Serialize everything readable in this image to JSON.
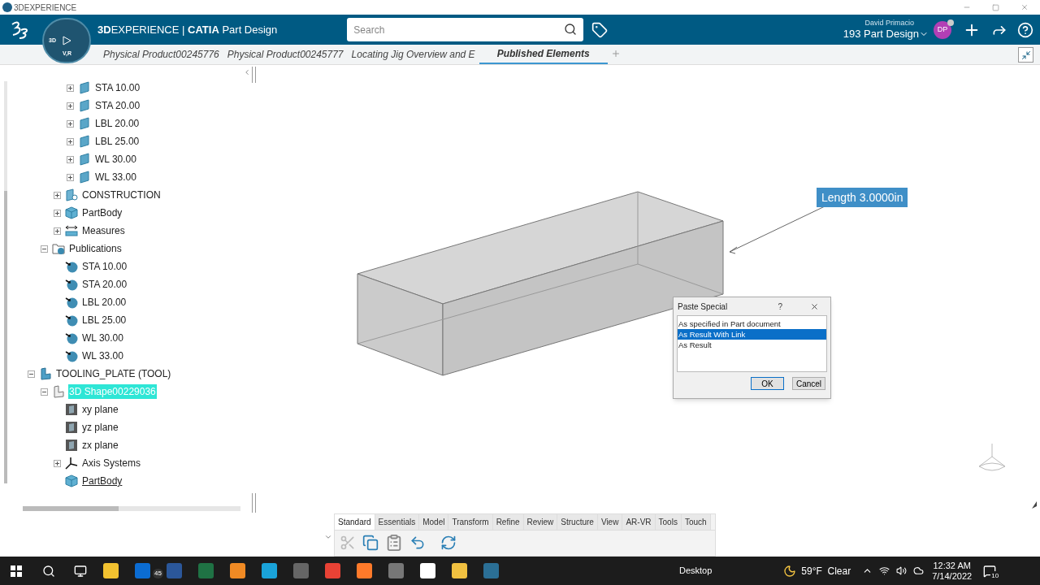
{
  "window": {
    "title": "3DEXPERIENCE"
  },
  "header": {
    "app_title": "**3D**EXPERIENCE | **CATIA** Part Design",
    "compass_labels": [
      "3D",
      "V,R"
    ],
    "search": {
      "placeholder": "Search"
    },
    "user_name": "David Primacio",
    "space": "193 Part Design",
    "avatar": "DP"
  },
  "tabs": [
    {
      "label": "Physical Product00245776",
      "selected": false
    },
    {
      "label": "Physical Product00245777",
      "selected": false
    },
    {
      "label": "Locating Jig Overview and E",
      "selected": false
    },
    {
      "label": "Published Elements",
      "selected": true
    }
  ],
  "tree": {
    "nodes": [
      {
        "children": [
          {
            "children": [
              {
                "children": [
                  {
                    "label": "STA 10.00",
                    "kind": "plane-set",
                    "expanded": false,
                    "selected": false
                  },
                  {
                    "label": "STA 20.00",
                    "kind": "plane-set",
                    "expanded": false,
                    "selected": false
                  },
                  {
                    "label": "LBL 20.00",
                    "kind": "plane-set",
                    "expanded": false,
                    "selected": false
                  },
                  {
                    "label": "LBL 25.00",
                    "kind": "plane-set",
                    "expanded": false,
                    "selected": false
                  },
                  {
                    "label": "WL 30.00",
                    "kind": "plane-set",
                    "expanded": false,
                    "selected": false
                  },
                  {
                    "label": "WL 33.00",
                    "kind": "plane-set",
                    "expanded": false,
                    "selected": false
                  }
                ]
              },
              {
                "label": "CONSTRUCTION",
                "kind": "construction",
                "expanded": false,
                "selected": false
              },
              {
                "label": "PartBody",
                "kind": "body",
                "expanded": false,
                "selected": false
              },
              {
                "label": "Measures",
                "kind": "measures",
                "expanded": false,
                "selected": false
              }
            ]
          },
          {
            "label": "Publications",
            "kind": "publications",
            "expanded": true,
            "selected": false,
            "children": [
              {
                "label": "STA 10.00",
                "kind": "publication",
                "selected": false
              },
              {
                "label": "STA 20.00",
                "kind": "publication",
                "selected": false
              },
              {
                "label": "LBL 20.00",
                "kind": "publication",
                "selected": false
              },
              {
                "label": "LBL 25.00",
                "kind": "publication",
                "selected": false
              },
              {
                "label": "WL 30.00",
                "kind": "publication",
                "selected": false
              },
              {
                "label": "WL 33.00",
                "kind": "publication",
                "selected": false
              }
            ]
          }
        ]
      },
      {
        "label": "TOOLING_PLATE (TOOL)",
        "kind": "product",
        "expanded": true,
        "selected": false,
        "children": [
          {
            "label": "3D Shape00229036",
            "kind": "shape",
            "expanded": true,
            "selected": true,
            "children": [
              {
                "label": "xy plane",
                "kind": "plane",
                "selected": false,
                "in_work": false
              },
              {
                "label": "yz plane",
                "kind": "plane",
                "selected": false,
                "in_work": false
              },
              {
                "label": "zx plane",
                "kind": "plane",
                "selected": false,
                "in_work": false
              },
              {
                "label": "Axis Systems",
                "kind": "axis",
                "expanded": false,
                "selected": false,
                "in_work": false
              },
              {
                "label": "PartBody",
                "kind": "body",
                "selected": false,
                "in_work": true
              }
            ]
          }
        ]
      }
    ]
  },
  "viewport": {
    "measure_label": "Length 3.0000in"
  },
  "dialog": {
    "title": "Paste Special",
    "help": "?",
    "options": [
      {
        "label": "As specified in Part document",
        "selected": false
      },
      {
        "label": "As Result With Link",
        "selected": true
      },
      {
        "label": "As Result",
        "selected": false
      }
    ],
    "buttons": [
      "OK",
      "Cancel"
    ]
  },
  "toolbar": {
    "tabs": [
      {
        "label": "Standard",
        "selected": true
      },
      {
        "label": "Essentials",
        "selected": false
      },
      {
        "label": "Model",
        "selected": false
      },
      {
        "label": "Transform",
        "selected": false
      },
      {
        "label": "Refine",
        "selected": false
      },
      {
        "label": "Review",
        "selected": false
      },
      {
        "label": "Structure",
        "selected": false
      },
      {
        "label": "View",
        "selected": false
      },
      {
        "label": "AR-VR",
        "selected": false
      },
      {
        "label": "Tools",
        "selected": false
      },
      {
        "label": "Touch",
        "selected": false
      }
    ]
  },
  "taskbar": {
    "mail_badge": "45",
    "desktop": "Desktop",
    "weather": "59°F  Clear",
    "time": "12:32 AM",
    "date": "7/14/2022",
    "notifications": "10"
  }
}
